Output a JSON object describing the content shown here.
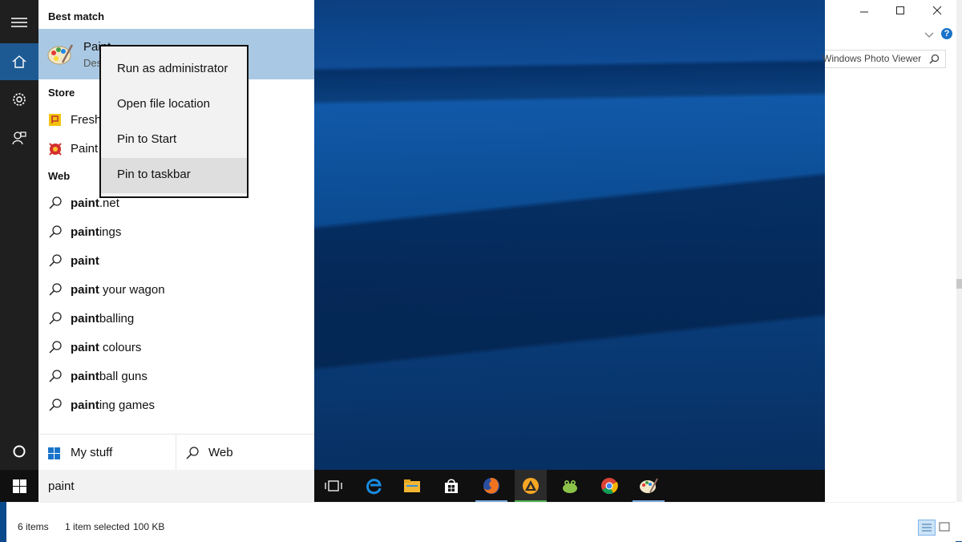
{
  "start_menu": {
    "best_match_heading": "Best match",
    "best_match": {
      "title": "Paint",
      "subtitle": "Desktop app"
    },
    "store_heading": "Store",
    "store_items": [
      "Fresh Paint",
      "Paint"
    ],
    "web_heading": "Web",
    "web_results": [
      {
        "bold": "paint",
        "rest": ".net"
      },
      {
        "bold": "paint",
        "rest": "ings"
      },
      {
        "bold": "paint",
        "rest": ""
      },
      {
        "bold": "paint",
        "rest": " your wagon"
      },
      {
        "bold": "paint",
        "rest": "balling"
      },
      {
        "bold": "paint",
        "rest": " colours"
      },
      {
        "bold": "paint",
        "rest": "ball guns"
      },
      {
        "bold": "paint",
        "rest": "ing games"
      }
    ],
    "tabs": {
      "my_stuff": "My stuff",
      "web": "Web"
    },
    "search_query": "paint"
  },
  "context_menu": {
    "items": [
      "Run as administrator",
      "Open file location",
      "Pin to Start",
      "Pin to taskbar"
    ],
    "highlighted_item": "Pin to taskbar"
  },
  "explorer": {
    "search_placeholder": "Windows Photo Viewer",
    "status_items": "6 items",
    "status_selected": "1 item selected",
    "status_size": "100 KB"
  },
  "taskbar": {
    "icons": [
      "task-view-icon",
      "edge-icon",
      "file-explorer-icon",
      "store-icon",
      "firefox-icon",
      "aimp-icon",
      "frog-app-icon",
      "chrome-icon",
      "paint-icon"
    ]
  },
  "colors": {
    "accent": "#1d5a93",
    "selection": "#a9c8e3",
    "rail": "#1f1f1f",
    "taskbar": "#101010"
  }
}
